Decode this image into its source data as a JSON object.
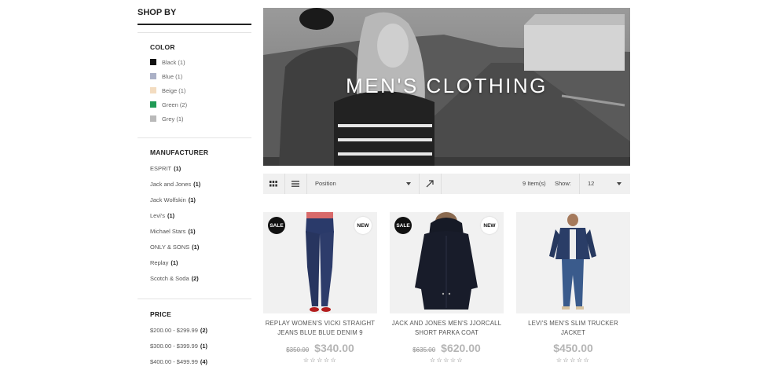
{
  "sidebar": {
    "title": "SHOP BY",
    "color": {
      "title": "COLOR",
      "items": [
        {
          "label": "Black (1)",
          "swatch": "#111111"
        },
        {
          "label": "Blue (1)",
          "swatch": "#aab0c6"
        },
        {
          "label": "Beige (1)",
          "swatch": "#f3dcc0"
        },
        {
          "label": "Green (2)",
          "swatch": "#1f9a55"
        },
        {
          "label": "Grey (1)",
          "swatch": "#b9b9b9"
        }
      ]
    },
    "manufacturer": {
      "title": "MANUFACTURER",
      "items": [
        {
          "name": "ESPRIT",
          "count": "(1)"
        },
        {
          "name": "Jack and Jones",
          "count": "(1)"
        },
        {
          "name": "Jack Wolfskin",
          "count": "(1)"
        },
        {
          "name": "Levi's",
          "count": "(1)"
        },
        {
          "name": "Michael Stars",
          "count": "(1)"
        },
        {
          "name": "ONLY & SONS",
          "count": "(1)"
        },
        {
          "name": "Replay",
          "count": "(1)"
        },
        {
          "name": "Scotch & Soda",
          "count": "(2)"
        }
      ]
    },
    "price": {
      "title": "PRICE",
      "items": [
        {
          "range": "$200.00 - $299.99",
          "count": "(2)"
        },
        {
          "range": "$300.00 - $399.99",
          "count": "(1)"
        },
        {
          "range": "$400.00 - $499.99",
          "count": "(4)"
        }
      ]
    }
  },
  "banner": {
    "title": "MEN'S CLOTHING"
  },
  "toolbar": {
    "sort_by": "Position",
    "items_count": "9 Item(s)",
    "show_label": "Show:",
    "limit": "12",
    "icons": [
      "grid-view-icon",
      "list-view-icon",
      "sort-direction-arrow-icon",
      "chevron-down-icon"
    ]
  },
  "products": [
    {
      "name": "REPLAY WOMEN'S VICKI STRAIGHT JEANS BLUE BLUE DENIM 9",
      "old_price": "$350.00",
      "price": "$340.00",
      "sale_badge": "SALE",
      "new_badge": "NEW",
      "rating_stars": "☆☆☆☆☆"
    },
    {
      "name": "JACK AND JONES MEN'S JJORCALL SHORT PARKA COAT",
      "old_price": "$635.00",
      "price": "$620.00",
      "sale_badge": "SALE",
      "new_badge": "NEW",
      "rating_stars": "☆☆☆☆☆"
    },
    {
      "name": "LEVI'S MEN'S SLIM TRUCKER JACKET",
      "old_price": "",
      "price": "$450.00",
      "sale_badge": "",
      "new_badge": "",
      "rating_stars": "☆☆☆☆☆"
    }
  ]
}
